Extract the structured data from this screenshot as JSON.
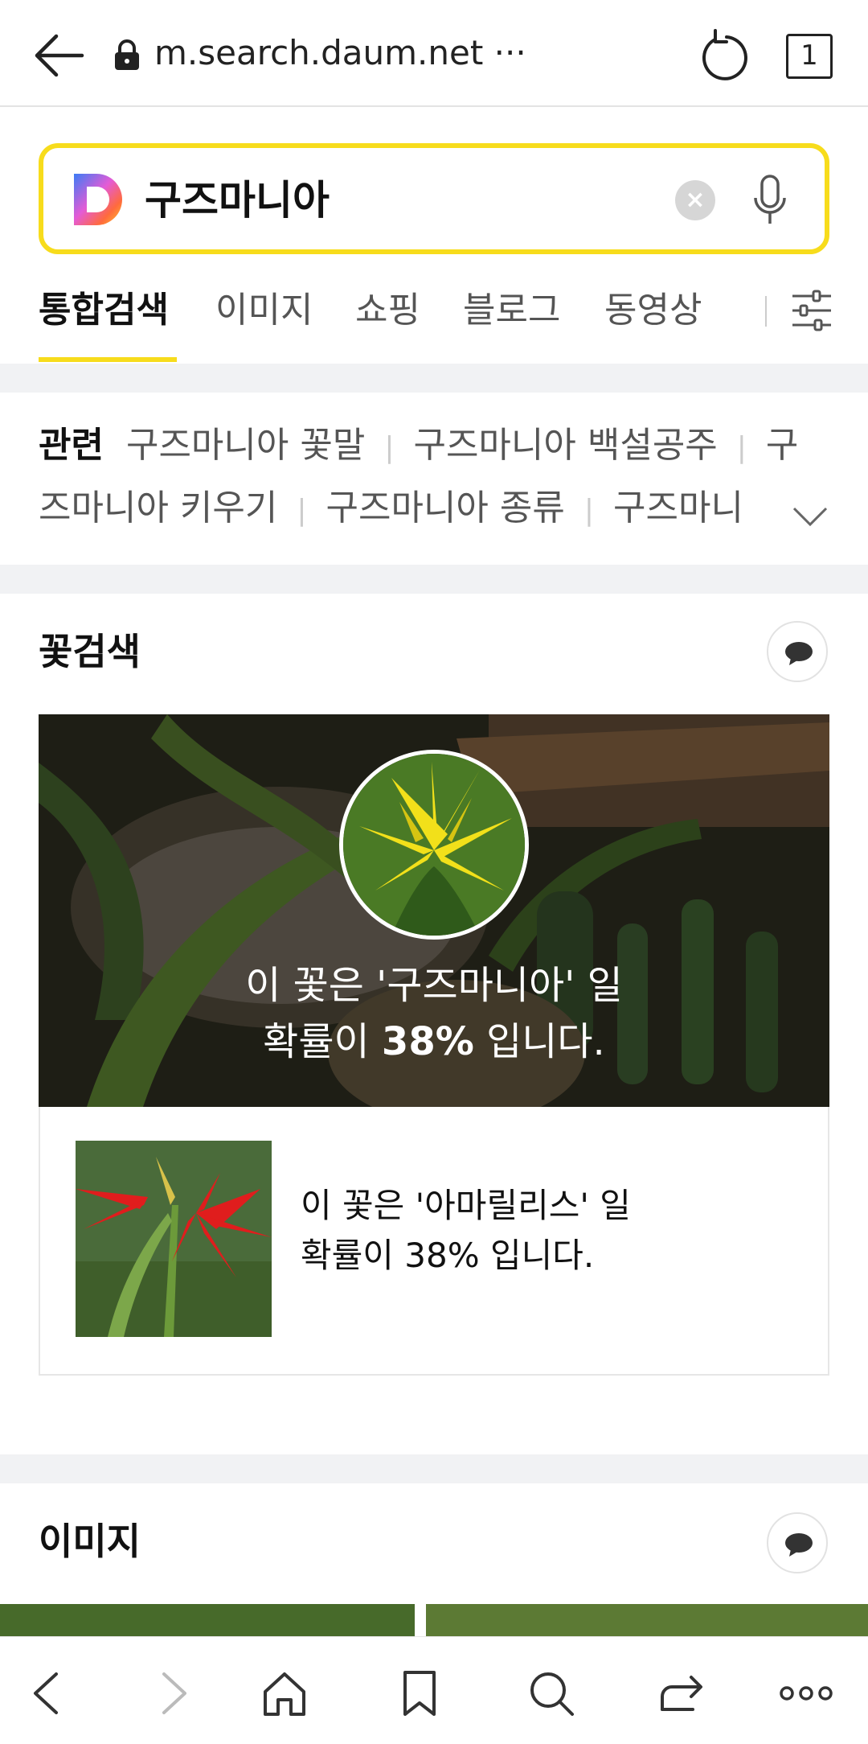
{
  "browser": {
    "url": "m.search.daum.net ···",
    "tab_count": "1"
  },
  "search": {
    "query": "구즈마니아",
    "clear_symbol": "×"
  },
  "tabs": [
    {
      "label": "통합검색",
      "active": true
    },
    {
      "label": "이미지"
    },
    {
      "label": "쇼핑"
    },
    {
      "label": "블로그"
    },
    {
      "label": "동영상"
    }
  ],
  "related": {
    "label": "관련",
    "items": [
      "구즈마니아 꽃말",
      "구즈마니아 백설공주",
      "구즈마니아 키우기",
      "구즈마니아 종류",
      "구즈마니"
    ],
    "wrap_head": "구",
    "wrap_tail": "즈마니아 키우기"
  },
  "flower_search": {
    "title": "꽃검색",
    "main_result_line1": "이 꽃은 '구즈마니아' 일",
    "main_result_line2_prefix": "확률이 ",
    "main_result_percent": "38%",
    "main_result_line2_suffix": " 입니다.",
    "alt_result_line1": "이 꽃은 '아마릴리스' 일",
    "alt_result_line2": "확률이 38% 입니다."
  },
  "images_section": {
    "title": "이미지"
  },
  "colors": {
    "accent": "#f7dc1c"
  }
}
